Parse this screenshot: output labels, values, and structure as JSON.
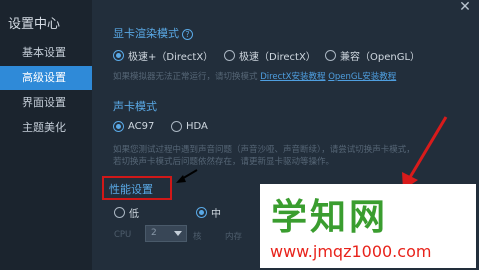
{
  "sidebar": {
    "title": "设置中心",
    "items": [
      {
        "label": "基本设置"
      },
      {
        "label": "高级设置"
      },
      {
        "label": "界面设置"
      },
      {
        "label": "主题美化"
      }
    ]
  },
  "gpu": {
    "title": "显卡渲染模式",
    "help": "?",
    "options": [
      {
        "label": "极速+（DirectX）",
        "checked": true
      },
      {
        "label": "极速（DirectX）",
        "checked": false
      },
      {
        "label": "兼容（OpenGL）",
        "checked": false
      }
    ],
    "hint_prefix": "如果模拟器无法正常运行，请切换模式",
    "link_directx": "DirectX安装教程",
    "link_opengl": "OpenGL安装教程"
  },
  "sound": {
    "title": "声卡模式",
    "options": [
      {
        "label": "AC97",
        "checked": true
      },
      {
        "label": "HDA",
        "checked": false
      }
    ],
    "hint_line1": "如果您测试过程中遇到声音问题（声音沙哑、声音断续），请尝试切换声卡模式，",
    "hint_line2": "若切换声卡模式后问题依然存在，请更新显卡驱动等操作。"
  },
  "performance": {
    "title": "性能设置",
    "options": [
      {
        "label": "低",
        "checked": false
      },
      {
        "label": "中",
        "checked": true
      }
    ],
    "cpu_label": "CPU",
    "cpu_value": "2",
    "cpu_unit": "核",
    "mem_label": "内存"
  },
  "watermark": {
    "text": "学知网",
    "url": "www.jmqz1000.com"
  },
  "colors": {
    "accent": "#5aa9e6",
    "active_item": "#2f8ad8",
    "highlight": "#d01818",
    "watermark_green": "#3a9d2f",
    "watermark_red": "#e8231b"
  }
}
